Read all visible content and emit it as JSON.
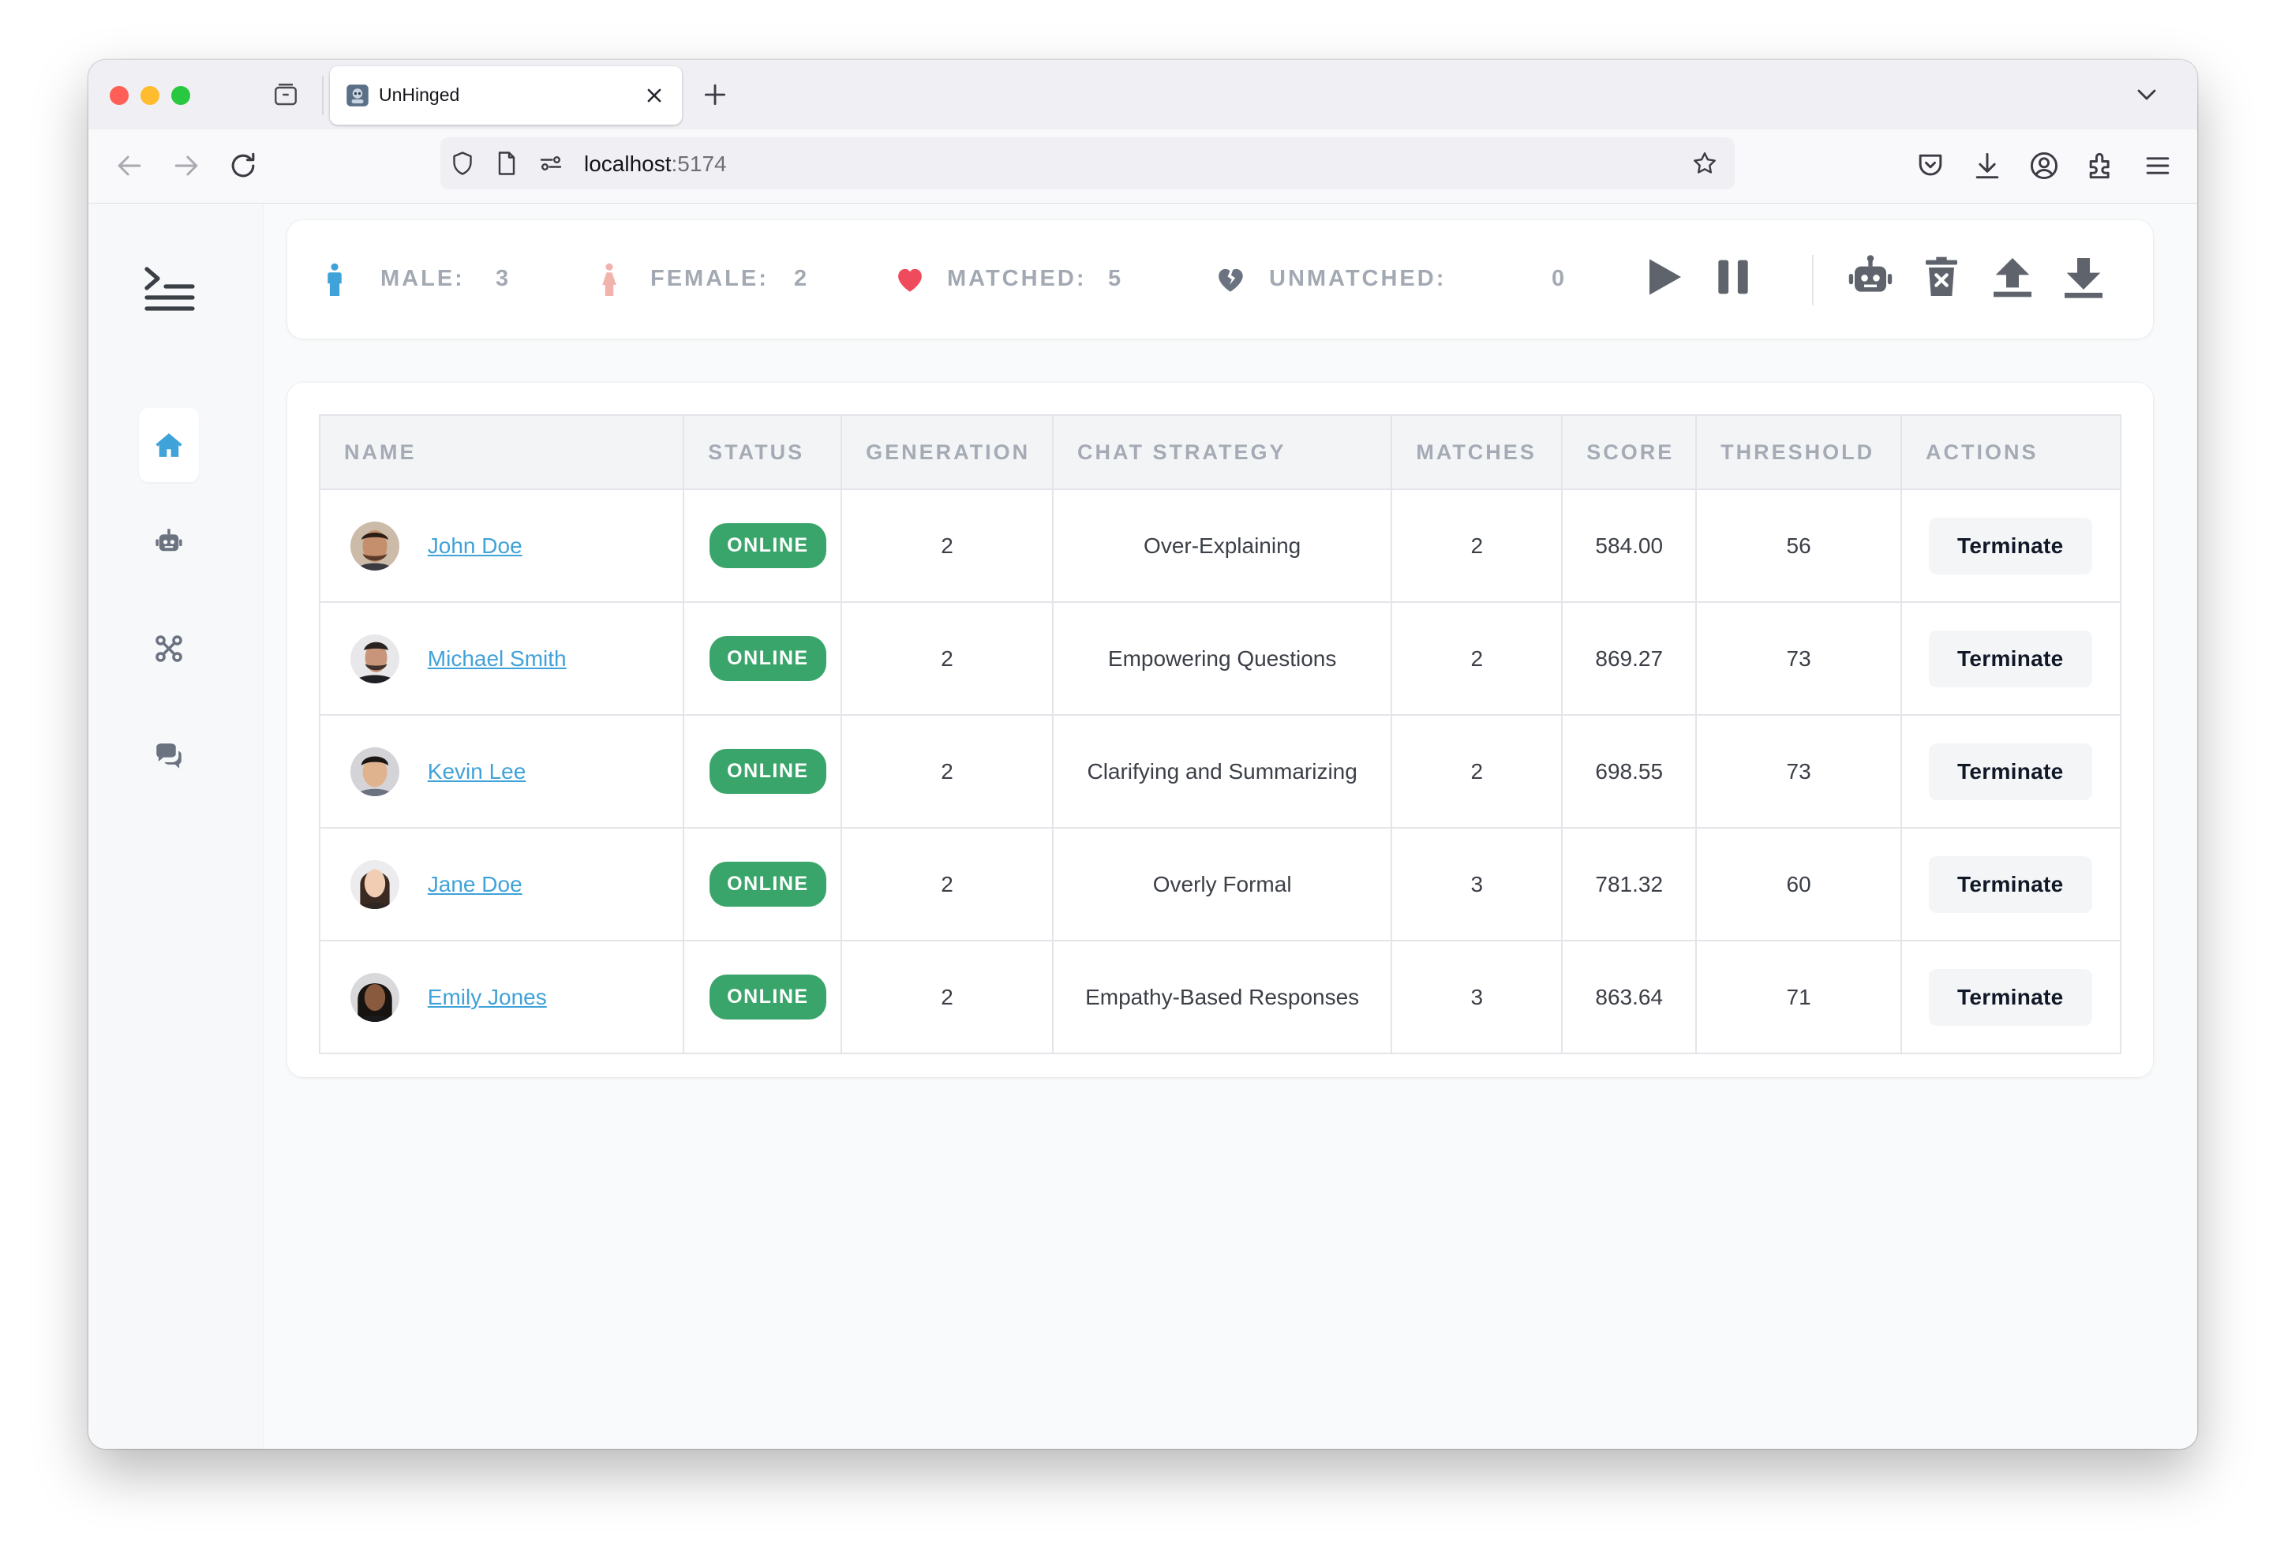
{
  "browser": {
    "tab_title": "UnHinged",
    "url_host": "localhost",
    "url_port": ":5174"
  },
  "stats": {
    "male_label": "MALE:",
    "male_value": "3",
    "female_label": "FEMALE:",
    "female_value": "2",
    "matched_label": "MATCHED:",
    "matched_value": "5",
    "unmatched_label": "UNMATCHED:",
    "unmatched_value": "0"
  },
  "colors": {
    "accent": "#3fa2d8",
    "male_icon": "#3fa2d8",
    "female_icon": "#f2b3ad",
    "heart": "#ef4b5c",
    "online": "#3aa56b"
  },
  "icons": {
    "sidebar": [
      "menu-toggle-icon",
      "home-icon",
      "robot-icon",
      "network-icon",
      "chat-icon"
    ],
    "controls": [
      "play-icon",
      "pause-icon",
      "robot-icon",
      "trash-icon",
      "upload-icon",
      "download-icon"
    ]
  },
  "table": {
    "headers": [
      "NAME",
      "STATUS",
      "GENERATION",
      "CHAT STRATEGY",
      "MATCHES",
      "SCORE",
      "THRESHOLD",
      "ACTIONS"
    ],
    "rows": [
      {
        "name": "John Doe",
        "status": "ONLINE",
        "generation": "2",
        "strategy": "Over-Explaining",
        "matches": "2",
        "score": "584.00",
        "threshold": "56",
        "action": "Terminate"
      },
      {
        "name": "Michael Smith",
        "status": "ONLINE",
        "generation": "2",
        "strategy": "Empowering Questions",
        "matches": "2",
        "score": "869.27",
        "threshold": "73",
        "action": "Terminate"
      },
      {
        "name": "Kevin Lee",
        "status": "ONLINE",
        "generation": "2",
        "strategy": "Clarifying and Summarizing",
        "matches": "2",
        "score": "698.55",
        "threshold": "73",
        "action": "Terminate"
      },
      {
        "name": "Jane Doe",
        "status": "ONLINE",
        "generation": "2",
        "strategy": "Overly Formal",
        "matches": "3",
        "score": "781.32",
        "threshold": "60",
        "action": "Terminate"
      },
      {
        "name": "Emily Jones",
        "status": "ONLINE",
        "generation": "2",
        "strategy": "Empathy-Based Responses",
        "matches": "3",
        "score": "863.64",
        "threshold": "71",
        "action": "Terminate"
      }
    ]
  }
}
